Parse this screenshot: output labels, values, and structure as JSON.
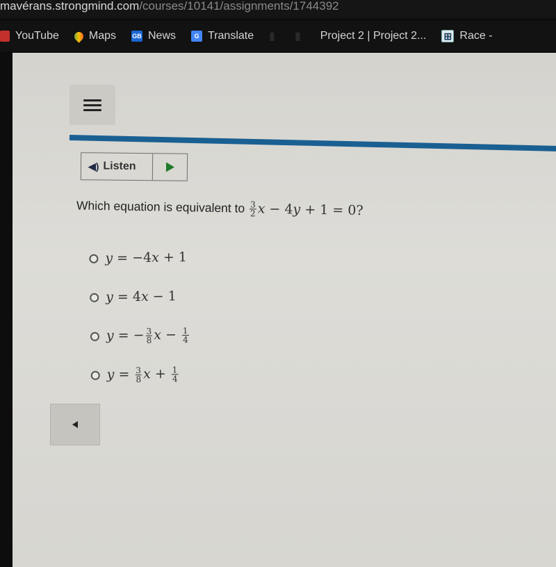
{
  "browser": {
    "url_host": "mavérans.strongmind.com",
    "url_path": "/courses/10141/assignments/1744392",
    "bookmarks": [
      {
        "label": "YouTube",
        "icon": "youtube-icon"
      },
      {
        "label": "Maps",
        "icon": "maps-icon"
      },
      {
        "label": "News",
        "icon": "news-icon",
        "badge": "GB"
      },
      {
        "label": "Translate",
        "icon": "translate-icon",
        "badge": "G"
      },
      {
        "label": "Project 2 | Project 2...",
        "icon": ""
      },
      {
        "label": "Race -",
        "icon": "race-icon",
        "badge": "⊞"
      }
    ]
  },
  "toolbar": {
    "menu_icon": "hamburger-menu-icon",
    "listen_label": "Listen",
    "speaker_glyph": "◀)",
    "play_icon": "play-icon"
  },
  "question": {
    "prefix": "Which equation is equivalent to",
    "equation": {
      "frac_num": "3",
      "frac_den": "2",
      "rest_a": "x",
      "rest_b": " − 4",
      "rest_c": "y",
      "rest_d": " + 1 = 0?"
    }
  },
  "options": [
    {
      "text_a": "y",
      "text_b": " = −4",
      "text_c": "x",
      "text_d": " + 1"
    },
    {
      "text_a": "y",
      "text_b": " = 4",
      "text_c": "x",
      "text_d": " − 1"
    },
    {
      "lhs": "y",
      "sign": " = −",
      "f1_num": "3",
      "f1_den": "8",
      "var": "x",
      "op": " − ",
      "f2_num": "1",
      "f2_den": "4"
    },
    {
      "lhs": "y",
      "sign": " = ",
      "f1_num": "3",
      "f1_den": "8",
      "var": "x",
      "op": " + ",
      "f2_num": "1",
      "f2_den": "4"
    }
  ],
  "navigation": {
    "back_icon": "back-arrow-icon"
  }
}
